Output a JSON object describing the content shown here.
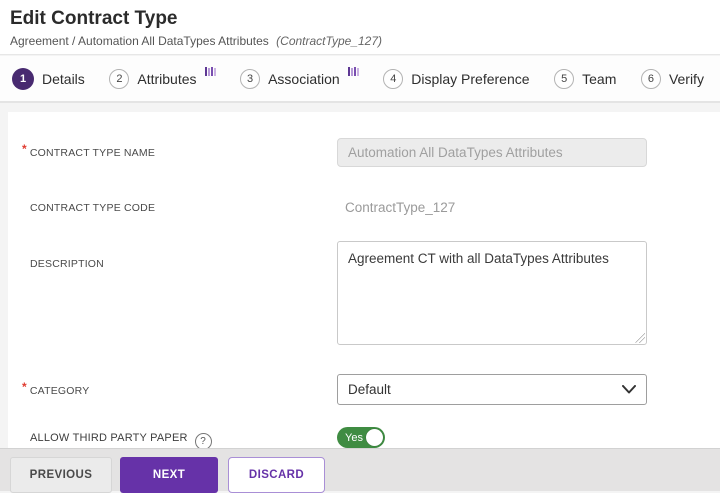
{
  "header": {
    "title": "Edit Contract Type",
    "breadcrumb": "Agreement / Automation All DataTypes Attributes",
    "context": "(ContractType_127)"
  },
  "stepper": {
    "steps": [
      {
        "number": "1",
        "label": "Details",
        "state": "active"
      },
      {
        "number": "2",
        "label": "Attributes",
        "state": "inactive",
        "icon": "purple-bars"
      },
      {
        "number": "3",
        "label": "Association",
        "state": "inactive",
        "icon": "purple-bars"
      },
      {
        "number": "4",
        "label": "Display Preference",
        "state": "inactive"
      },
      {
        "number": "5",
        "label": "Team",
        "state": "inactive"
      },
      {
        "number": "6",
        "label": "Verify",
        "state": "inactive"
      }
    ]
  },
  "form": {
    "required_marker": "*",
    "contract_type_name": {
      "label": "CONTRACT TYPE NAME",
      "value": "Automation All DataTypes Attributes",
      "required": true,
      "disabled": true
    },
    "contract_type_code": {
      "label": "CONTRACT TYPE CODE",
      "value": "ContractType_127",
      "readonly": true
    },
    "description": {
      "label": "DESCRIPTION",
      "value": "Agreement CT with all DataTypes Attributes"
    },
    "category": {
      "label": "CATEGORY",
      "value": "Default",
      "required": true
    },
    "allow_third_party_paper": {
      "label": "ALLOW THIRD PARTY PAPER",
      "help": "?",
      "toggle_value": "Yes",
      "toggle_state": "on"
    }
  },
  "footer": {
    "previous_label": "PREVIOUS",
    "next_label": "NEXT",
    "discard_label": "DISCARD"
  },
  "colors": {
    "accent_purple": "#6632a8",
    "step_active_purple": "#482a70",
    "toggle_green": "#3f8c42",
    "required_red": "#e03c31"
  }
}
